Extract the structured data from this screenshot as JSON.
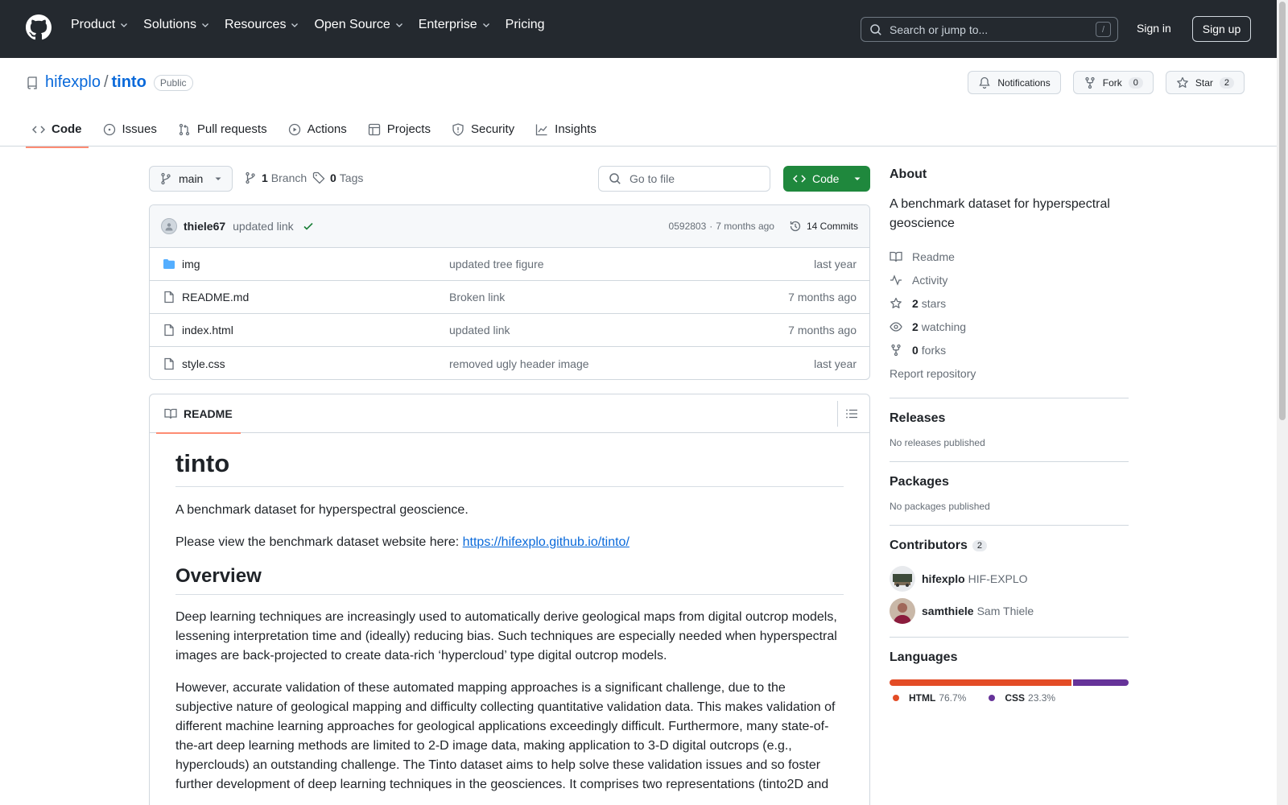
{
  "header": {
    "nav": [
      "Product",
      "Solutions",
      "Resources",
      "Open Source",
      "Enterprise",
      "Pricing"
    ],
    "search_placeholder": "Search or jump to...",
    "search_shortcut": "/",
    "sign_in": "Sign in",
    "sign_up": "Sign up"
  },
  "repo": {
    "owner": "hifexplo",
    "separator": "/",
    "name": "tinto",
    "visibility": "Public",
    "notifications_label": "Notifications",
    "fork_label": "Fork",
    "fork_count": "0",
    "star_label": "Star",
    "star_count": "2",
    "tabs": [
      "Code",
      "Issues",
      "Pull requests",
      "Actions",
      "Projects",
      "Security",
      "Insights"
    ]
  },
  "toolbar": {
    "branch": "main",
    "branch_count": "1",
    "branch_label": "Branch",
    "tag_count": "0",
    "tag_label": "Tags",
    "goto_placeholder": "Go to file",
    "code_label": "Code"
  },
  "commit": {
    "author": "thiele67",
    "message": "updated link",
    "hash": "0592803",
    "dot": "·",
    "time": "7 months ago",
    "count_label": "14 Commits"
  },
  "files": [
    {
      "name": "img",
      "type": "dir",
      "message": "updated tree figure",
      "date": "last year"
    },
    {
      "name": "README.md",
      "type": "file",
      "message": "Broken link",
      "date": "7 months ago"
    },
    {
      "name": "index.html",
      "type": "file",
      "message": "updated link",
      "date": "7 months ago"
    },
    {
      "name": "style.css",
      "type": "file",
      "message": "removed ugly header image",
      "date": "last year"
    }
  ],
  "readme": {
    "tab_label": "README",
    "title": "tinto",
    "intro": "A benchmark dataset for hyperspectral geoscience.",
    "view_text": "Please view the benchmark dataset website here: ",
    "view_link": "https://hifexplo.github.io/tinto/",
    "overview_heading": "Overview",
    "para1": "Deep learning techniques are increasingly used to automatically derive geological maps from digital outcrop models, lessening interpretation time and (ideally) reducing bias. Such techniques are especially needed when hyperspectral images are back-projected to create data-rich ‘hypercloud’ type digital outcrop models.",
    "para2": "However, accurate validation of these automated mapping approaches is a significant challenge, due to the subjective nature of geological mapping and difficulty collecting quantitative validation data. This makes validation of different machine learning approaches for geological applications exceedingly difficult. Furthermore, many state-of-the-art deep learning methods are limited to 2-D image data, making application to 3-D digital outcrops (e.g., hyperclouds) an outstanding challenge. The Tinto dataset aims to help solve these validation issues and so foster further development of deep learning techniques in the geosciences. It comprises two representations (tinto2D and"
  },
  "about": {
    "heading": "About",
    "description": "A benchmark dataset for hyperspectral geoscience",
    "readme": "Readme",
    "activity": "Activity",
    "stars_count": "2",
    "stars_label": "stars",
    "watching_count": "2",
    "watching_label": "watching",
    "forks_count": "0",
    "forks_label": "forks",
    "report": "Report repository"
  },
  "releases": {
    "heading": "Releases",
    "empty": "No releases published"
  },
  "packages": {
    "heading": "Packages",
    "empty": "No packages published"
  },
  "contributors": {
    "heading": "Contributors",
    "count": "2",
    "list": [
      {
        "login": "hifexplo",
        "name": "HIF-EXPLO"
      },
      {
        "login": "samthiele",
        "name": "Sam Thiele"
      }
    ]
  },
  "languages": {
    "heading": "Languages",
    "list": [
      {
        "name": "HTML",
        "percent": "76.7%",
        "value": 76.7,
        "color": "#e34c26"
      },
      {
        "name": "CSS",
        "percent": "23.3%",
        "value": 23.3,
        "color": "#663399"
      }
    ]
  },
  "colors": {
    "accent": "#0969da",
    "header_bg": "#24292f",
    "code_btn": "#1f883d",
    "tab_underline": "#fd8c73"
  }
}
